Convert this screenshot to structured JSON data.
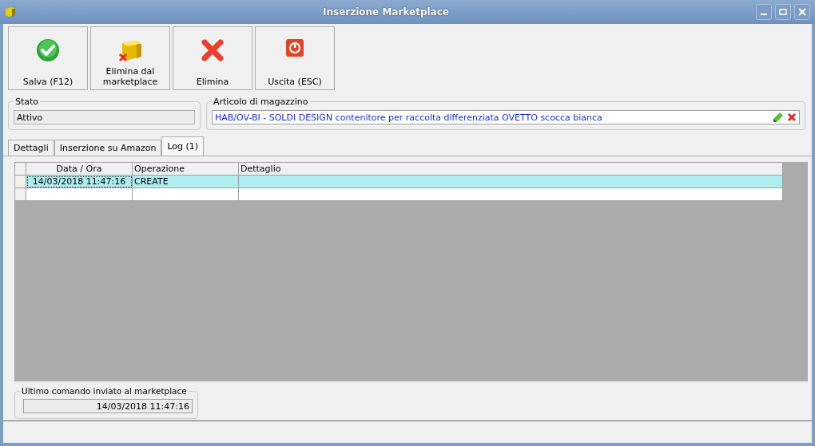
{
  "window": {
    "title": "Inserzione Marketplace"
  },
  "toolbar": [
    {
      "kind": "save",
      "label": "Salva (F12)"
    },
    {
      "kind": "remove-marketplace",
      "label": "Elimina dal marketplace"
    },
    {
      "kind": "delete",
      "label": "Elimina"
    },
    {
      "kind": "exit",
      "label": "Uscita (ESC)"
    }
  ],
  "stato": {
    "label": "Stato",
    "value": "Attivo"
  },
  "articolo": {
    "label": "Articolo di magazzino",
    "value": "HAB/OV-BI - SOLDI DESIGN contenitore per raccolta differenziata OVETTO scocca bianca"
  },
  "tabs": [
    {
      "label": "Dettagli",
      "selected": false
    },
    {
      "label": "Inserzione su Amazon",
      "selected": false
    },
    {
      "label": "Log (1)",
      "selected": true
    }
  ],
  "table": {
    "columns": [
      "Data / Ora",
      "Operazione",
      "Dettaglio"
    ],
    "rows": [
      {
        "cells": [
          "14/03/2018 11:47:16",
          "CREATE",
          ""
        ],
        "selected": true
      }
    ]
  },
  "last_command": {
    "label": "Ultimo comando inviato al marketplace",
    "value": "14/03/2018 11:47:16"
  }
}
